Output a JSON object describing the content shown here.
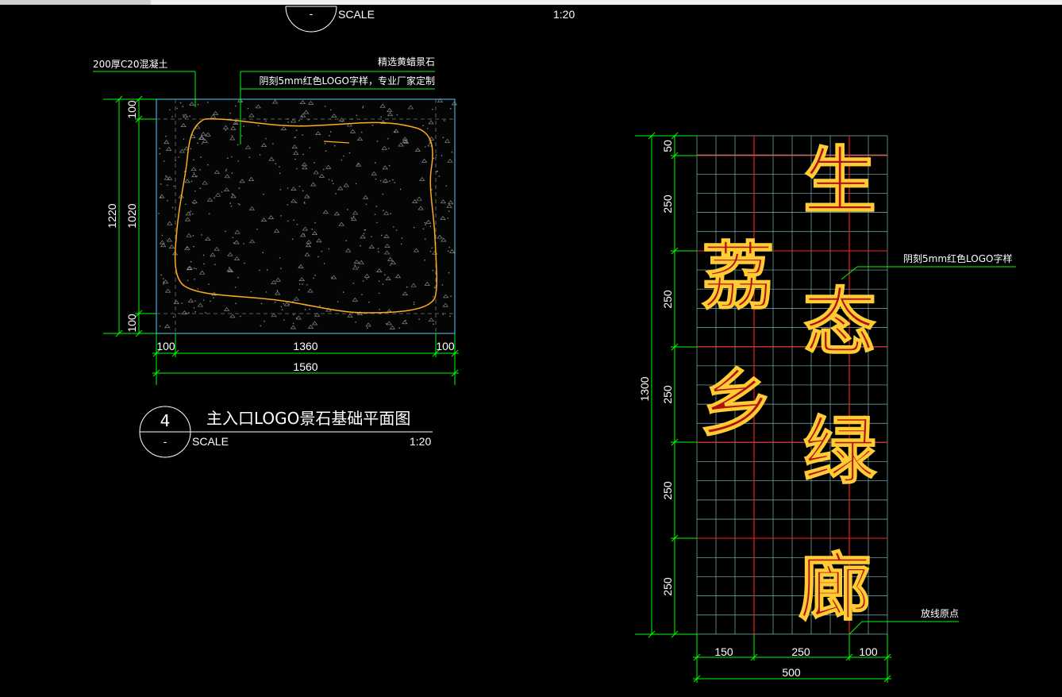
{
  "colors": {
    "background": "#000000",
    "dimension": "#00ff00",
    "outline": "#55ccff",
    "stone": "#ffaa22",
    "grid": "#7fb5b5",
    "grid_major": "#ff2020",
    "text": "#ffffff"
  },
  "top_fragment": {
    "bubble_lower": "-",
    "scale_label": "SCALE",
    "scale_ratio": "1:20"
  },
  "plan": {
    "notes": {
      "concrete": "200厚C20混凝土",
      "stone": "精选黄蜡景石",
      "engrave": "阴刻5mm红色LOGO字样，专业厂家定制"
    },
    "dims_vertical": {
      "top": "100",
      "middle": "1020",
      "bottom": "100",
      "total": "1220"
    },
    "dims_horizontal": {
      "left": "100",
      "middle": "1360",
      "right": "100",
      "total": "1560"
    },
    "title_block": {
      "number": "4",
      "sheet": "-",
      "title": "主入口LOGO景石基础平面图",
      "scale_label": "SCALE",
      "scale_ratio": "1:20"
    }
  },
  "logo": {
    "note_engrave": "阴刻5mm红色LOGO字样",
    "note_origin": "放线原点",
    "dims_vertical": [
      "50",
      "250",
      "250",
      "250",
      "250",
      "250"
    ],
    "dim_total": "1300",
    "dims_horizontal": [
      "150",
      "250",
      "100"
    ],
    "dim_width_total": "500",
    "column_right": [
      "生",
      "态",
      "绿",
      "廊"
    ],
    "column_left": [
      "荔",
      "乡"
    ]
  }
}
